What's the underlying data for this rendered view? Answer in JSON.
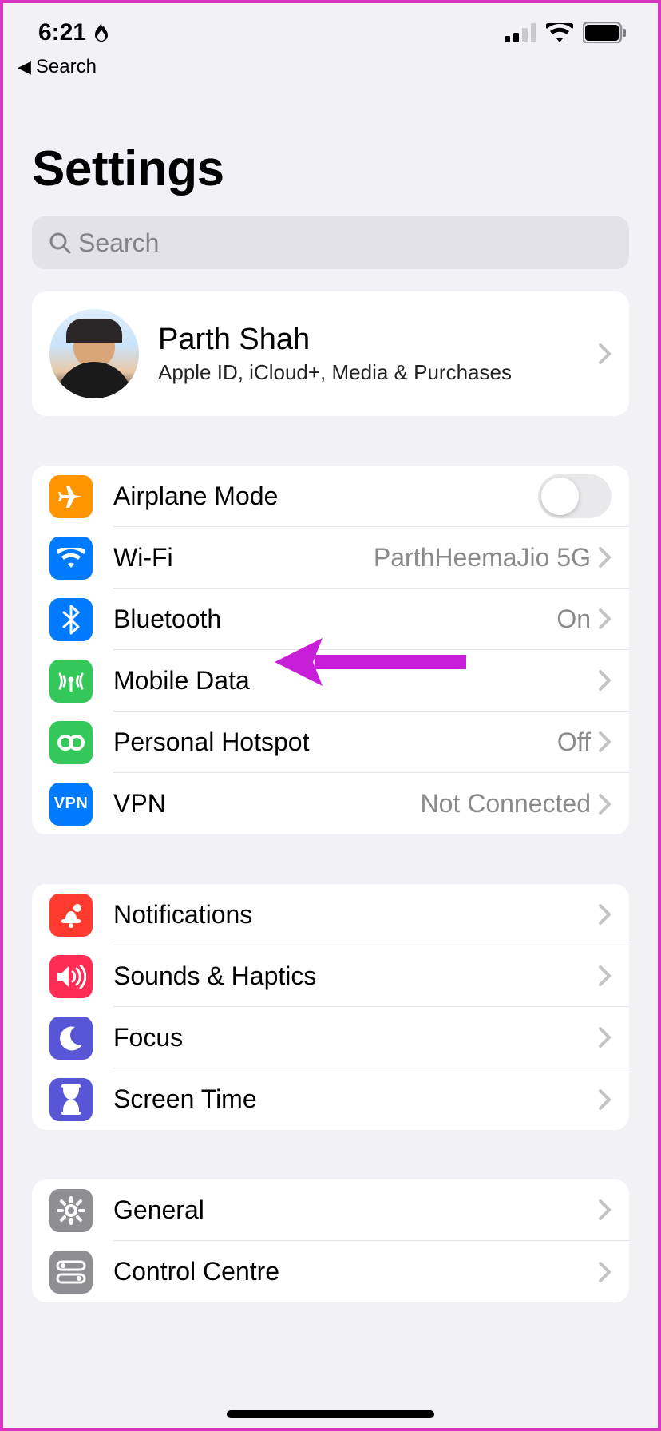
{
  "statusBar": {
    "time": "6:21",
    "backLabel": "Search"
  },
  "title": "Settings",
  "search": {
    "placeholder": "Search"
  },
  "profile": {
    "name": "Parth Shah",
    "subtitle": "Apple ID, iCloud+, Media & Purchases"
  },
  "connectivity": {
    "airplane": {
      "label": "Airplane Mode"
    },
    "wifi": {
      "label": "Wi-Fi",
      "value": "ParthHeemaJio 5G"
    },
    "bluetooth": {
      "label": "Bluetooth",
      "value": "On"
    },
    "mobileData": {
      "label": "Mobile Data"
    },
    "hotspot": {
      "label": "Personal Hotspot",
      "value": "Off"
    },
    "vpn": {
      "label": "VPN",
      "value": "Not Connected",
      "badge": "VPN"
    }
  },
  "notifications": {
    "notifications": {
      "label": "Notifications"
    },
    "sounds": {
      "label": "Sounds & Haptics"
    },
    "focus": {
      "label": "Focus"
    },
    "screenTime": {
      "label": "Screen Time"
    }
  },
  "general": {
    "general": {
      "label": "General"
    },
    "control": {
      "label": "Control Centre"
    }
  }
}
